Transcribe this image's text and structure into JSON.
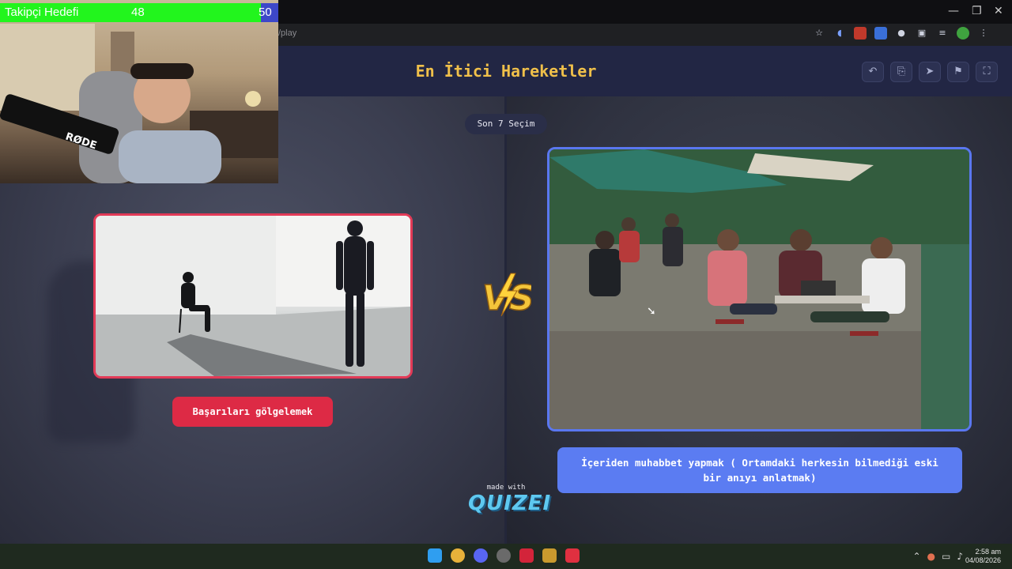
{
  "browser": {
    "url_text": "/play",
    "window_controls": [
      "minimize-icon",
      "restore-icon",
      "close-icon"
    ],
    "toolbar_icons": [
      "star-icon",
      "audio-icon",
      "extension-icon",
      "extension-icon",
      "extension-icon",
      "puzzle-icon",
      "media-icon",
      "profile-icon",
      "menu-icon"
    ]
  },
  "app": {
    "title": "En İtici Hareketler",
    "header_buttons": [
      "undo-icon",
      "share-icon",
      "send-icon",
      "flag-icon",
      "fullscreen-icon"
    ],
    "last_choice_badge": "Son 7 Seçim",
    "left_option": {
      "label": "Başarıları gölgelemek",
      "image_desc": "silhouette figures in white room",
      "border_color": "#e23a57"
    },
    "right_option": {
      "label": "İçeriden muhabbet yapmak ( Ortamdaki herkesin bilmediği eski bir anıyı anlatmak)",
      "image_desc": "people sitting at outdoor cafe",
      "border_color": "#5a77f0"
    },
    "vs_label": "VS",
    "made_with": "made with",
    "brand": "QUIZEI"
  },
  "stream_overlay": {
    "goal_title": "Takipçi Hedefi",
    "goal_current": "48",
    "goal_target": "50",
    "goal_progress": 0.96,
    "colors": {
      "fill": "#22f51d",
      "rest": "#3d47c9"
    }
  },
  "taskbar": {
    "apps": [
      "windows-start-icon",
      "chrome-icon",
      "discord-icon",
      "app-icon",
      "app-icon",
      "app-icon",
      "app-icon"
    ],
    "clock_time": "2:58 am",
    "clock_date": "04/08/2026"
  }
}
